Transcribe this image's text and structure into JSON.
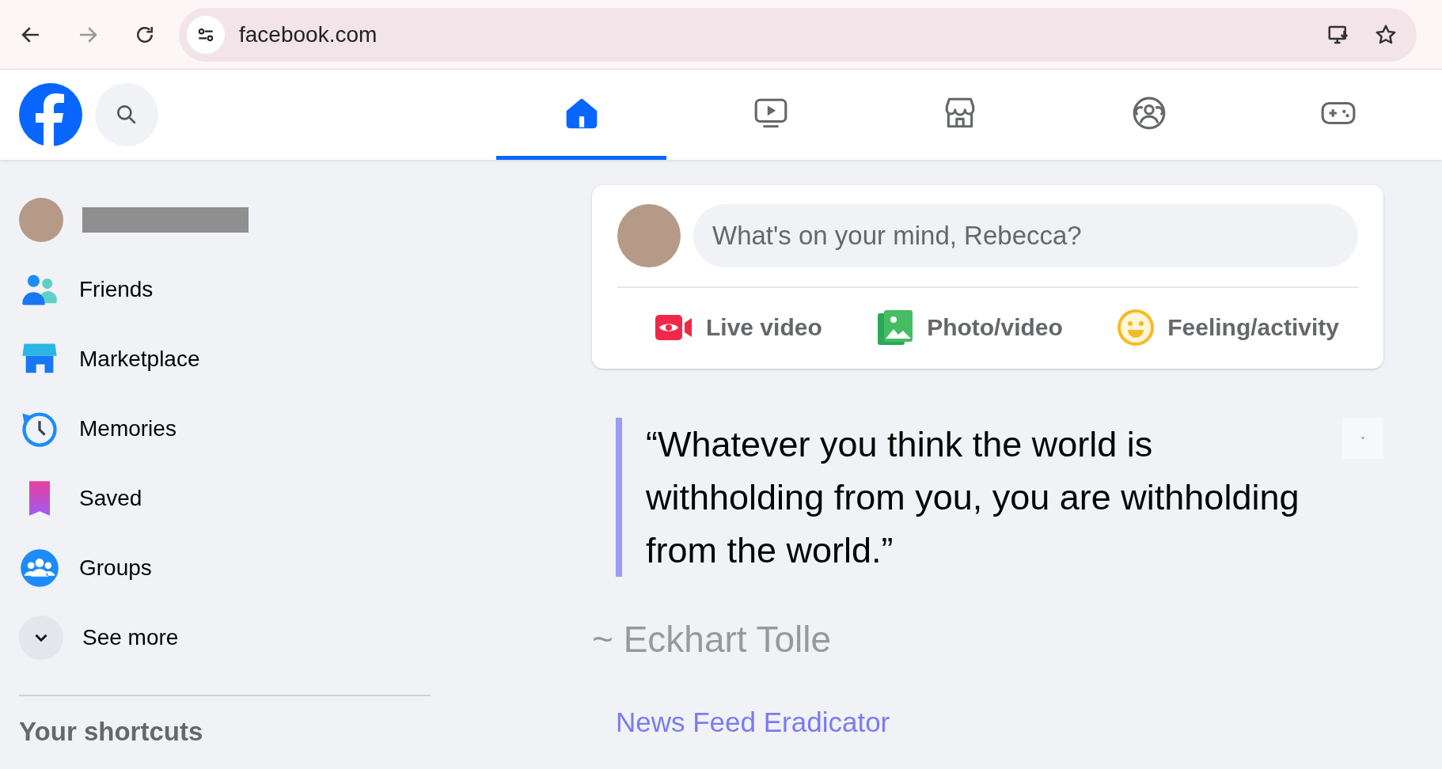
{
  "browser": {
    "url": "facebook.com"
  },
  "nav_tabs": [
    {
      "kind": "home",
      "selected": true
    },
    {
      "kind": "video",
      "selected": false
    },
    {
      "kind": "store",
      "selected": false
    },
    {
      "kind": "people",
      "selected": false
    },
    {
      "kind": "gaming",
      "selected": false
    }
  ],
  "sidebar": {
    "items": [
      {
        "kind": "friends",
        "label": "Friends"
      },
      {
        "kind": "marketplace",
        "label": "Marketplace"
      },
      {
        "kind": "memories",
        "label": "Memories"
      },
      {
        "kind": "saved",
        "label": "Saved"
      },
      {
        "kind": "groups",
        "label": "Groups"
      },
      {
        "kind": "more",
        "label": "See more"
      }
    ],
    "shortcuts_heading": "Your shortcuts"
  },
  "composer": {
    "placeholder": "What's on your mind, Rebecca?",
    "actions": [
      {
        "kind": "live",
        "label": "Live video"
      },
      {
        "kind": "photo",
        "label": "Photo/video"
      },
      {
        "kind": "feeling",
        "label": "Feeling/activity"
      }
    ]
  },
  "quote": {
    "text": "“Whatever you think the world is withholding from you, you are withholding from the world.”",
    "author": "~ Eckhart Tolle",
    "link": "News Feed Eradicator"
  }
}
